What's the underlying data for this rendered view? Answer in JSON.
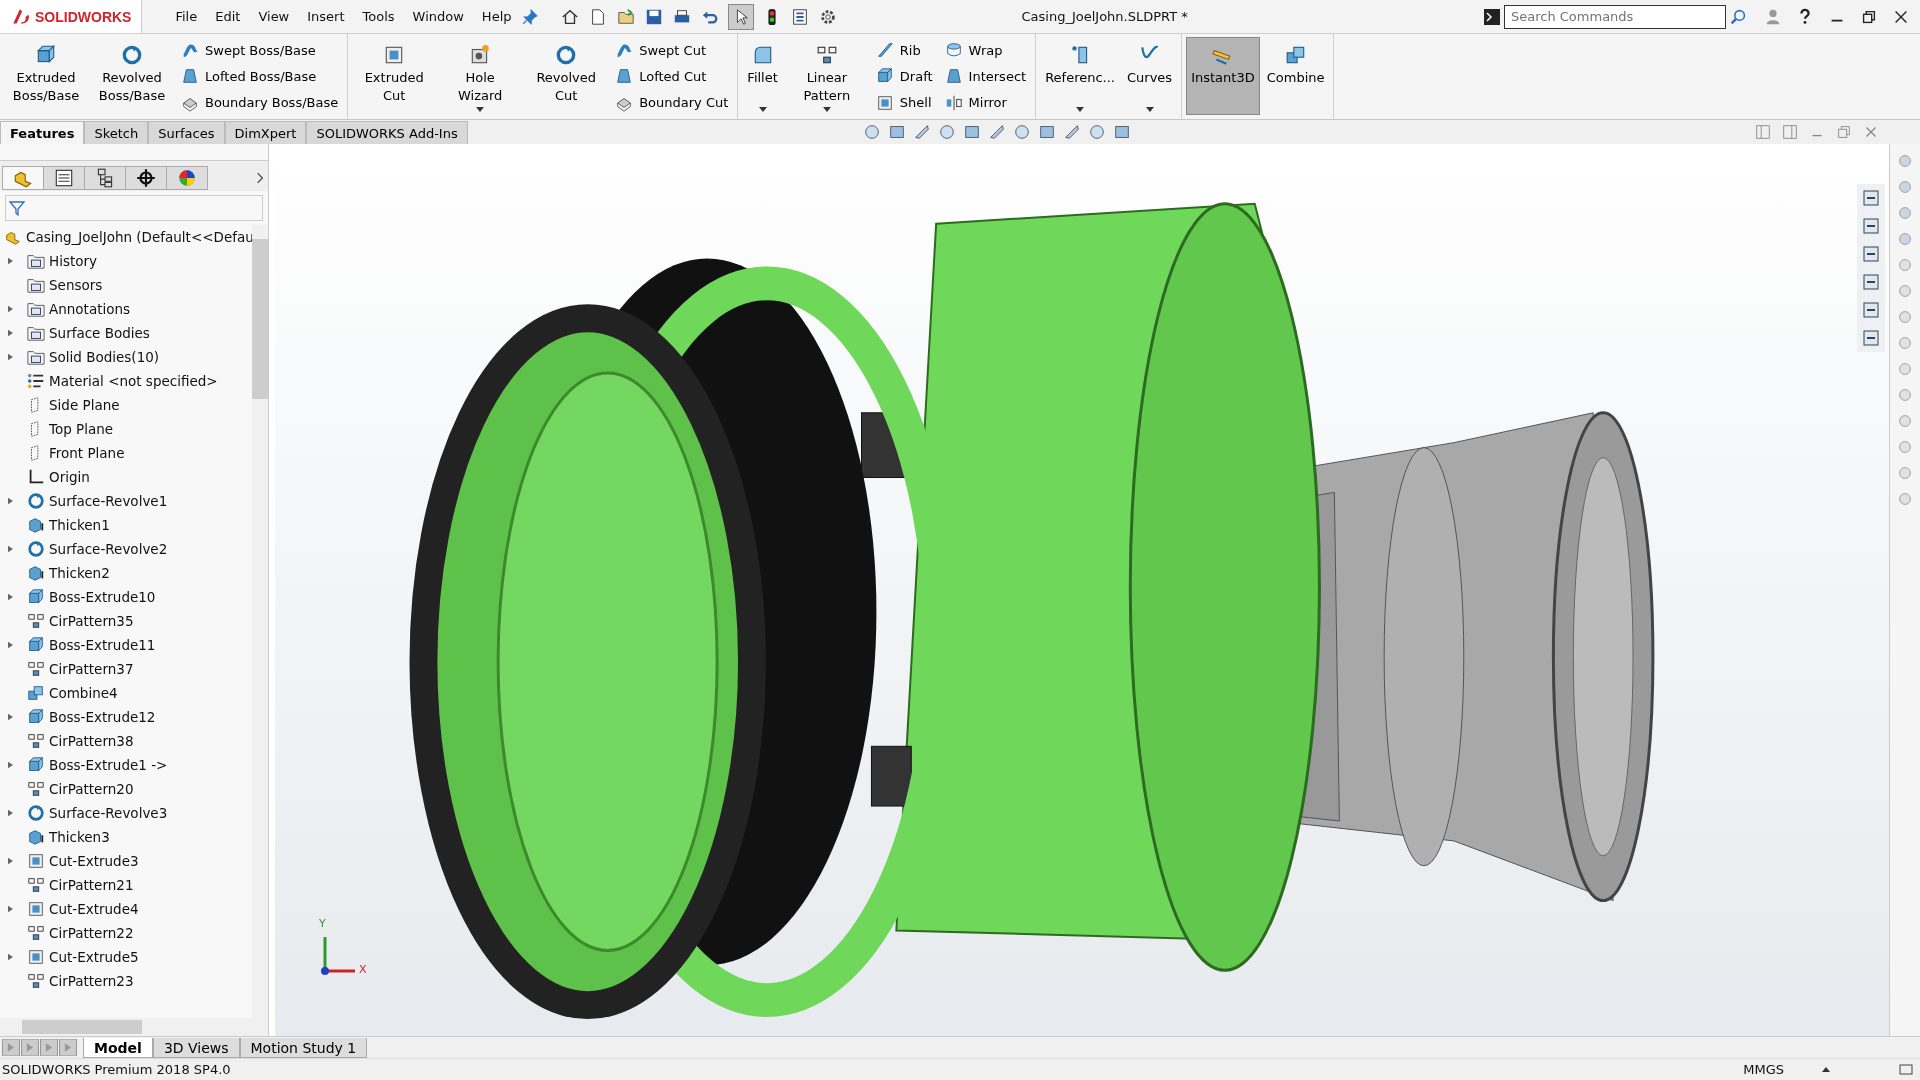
{
  "logo": "SOLIDWORKS",
  "menu": [
    "File",
    "Edit",
    "View",
    "Insert",
    "Tools",
    "Window",
    "Help"
  ],
  "title": "Casing_JoelJohn.SLDPRT *",
  "search": {
    "placeholder": "Search Commands"
  },
  "ribbon": [
    {
      "columns": [
        {
          "kind": "large",
          "buttons": [
            {
              "label": "Extruded Boss/Base",
              "kind": "extrude",
              "dropdown": false,
              "on": false
            }
          ]
        },
        {
          "kind": "large",
          "buttons": [
            {
              "label": "Revolved Boss/Base",
              "kind": "revolve",
              "dropdown": false,
              "on": false
            }
          ]
        },
        {
          "kind": "stack",
          "buttons": [
            {
              "label": "Swept Boss/Base",
              "kind": "sweep"
            },
            {
              "label": "Lofted Boss/Base",
              "kind": "loft"
            },
            {
              "label": "Boundary Boss/Base",
              "kind": "boundary"
            }
          ]
        }
      ]
    },
    {
      "columns": [
        {
          "kind": "large",
          "buttons": [
            {
              "label": "Extruded Cut",
              "kind": "cut",
              "dropdown": false,
              "on": false
            }
          ]
        },
        {
          "kind": "large",
          "buttons": [
            {
              "label": "Hole Wizard",
              "kind": "hole",
              "dropdown": true,
              "on": false
            }
          ]
        },
        {
          "kind": "large",
          "buttons": [
            {
              "label": "Revolved Cut",
              "kind": "revolve",
              "dropdown": false,
              "on": false
            }
          ]
        },
        {
          "kind": "stack",
          "buttons": [
            {
              "label": "Swept Cut",
              "kind": "sweep"
            },
            {
              "label": "Lofted Cut",
              "kind": "loft"
            },
            {
              "label": "Boundary Cut",
              "kind": "boundary"
            }
          ]
        }
      ]
    },
    {
      "columns": [
        {
          "kind": "large",
          "buttons": [
            {
              "label": "Fillet",
              "kind": "fillet",
              "dropdown": true,
              "on": false
            }
          ]
        },
        {
          "kind": "large",
          "buttons": [
            {
              "label": "Linear Pattern",
              "kind": "pattern",
              "dropdown": true,
              "on": false
            }
          ]
        },
        {
          "kind": "stack",
          "buttons": [
            {
              "label": "Rib",
              "kind": "rib"
            },
            {
              "label": "Draft",
              "kind": "extrude"
            },
            {
              "label": "Shell",
              "kind": "cut"
            }
          ]
        },
        {
          "kind": "stack",
          "buttons": [
            {
              "label": "Wrap",
              "kind": "wrap"
            },
            {
              "label": "Intersect",
              "kind": "loft"
            },
            {
              "label": "Mirror",
              "kind": "mirror"
            }
          ]
        }
      ]
    },
    {
      "columns": [
        {
          "kind": "large",
          "buttons": [
            {
              "label": "Referenc...",
              "kind": "plane",
              "dropdown": true,
              "on": false
            }
          ]
        },
        {
          "kind": "large",
          "buttons": [
            {
              "label": "Curves",
              "kind": "curve",
              "dropdown": true,
              "on": false
            }
          ]
        }
      ]
    },
    {
      "columns": [
        {
          "kind": "large",
          "buttons": [
            {
              "label": "Instant3D",
              "kind": "ruler",
              "dropdown": false,
              "on": true
            }
          ]
        },
        {
          "kind": "large",
          "buttons": [
            {
              "label": "Combine",
              "kind": "combine",
              "dropdown": false,
              "on": false
            }
          ]
        }
      ]
    }
  ],
  "command_tabs": [
    {
      "label": "Features",
      "selected": true
    },
    {
      "label": "Sketch",
      "selected": false
    },
    {
      "label": "Surfaces",
      "selected": false
    },
    {
      "label": "DimXpert",
      "selected": false
    },
    {
      "label": "SOLIDWORKS Add-Ins",
      "selected": false
    }
  ],
  "tree": {
    "root": "Casing_JoelJohn  (Default<<Defau",
    "items": [
      {
        "label": "History",
        "kind": "folder",
        "expandable": true
      },
      {
        "label": "Sensors",
        "kind": "folder",
        "expandable": false
      },
      {
        "label": "Annotations",
        "kind": "folder",
        "expandable": true
      },
      {
        "label": "Surface Bodies",
        "kind": "folder",
        "expandable": true
      },
      {
        "label": "Solid Bodies(10)",
        "kind": "folder",
        "expandable": true
      },
      {
        "label": "Material <not specified>",
        "kind": "material",
        "expandable": false
      },
      {
        "label": "Side Plane",
        "kind": "plane",
        "expandable": false
      },
      {
        "label": "Top Plane",
        "kind": "plane",
        "expandable": false
      },
      {
        "label": "Front Plane",
        "kind": "plane",
        "expandable": false
      },
      {
        "label": "Origin",
        "kind": "origin",
        "expandable": false
      },
      {
        "label": "Surface-Revolve1",
        "kind": "revolve",
        "expandable": true
      },
      {
        "label": "Thicken1",
        "kind": "thicken",
        "expandable": false
      },
      {
        "label": "Surface-Revolve2",
        "kind": "revolve",
        "expandable": true
      },
      {
        "label": "Thicken2",
        "kind": "thicken",
        "expandable": false
      },
      {
        "label": "Boss-Extrude10",
        "kind": "extrude",
        "expandable": true
      },
      {
        "label": "CirPattern35",
        "kind": "pattern",
        "expandable": false
      },
      {
        "label": "Boss-Extrude11",
        "kind": "extrude",
        "expandable": true
      },
      {
        "label": "CirPattern37",
        "kind": "pattern",
        "expandable": false
      },
      {
        "label": "Combine4",
        "kind": "combine",
        "expandable": false
      },
      {
        "label": "Boss-Extrude12",
        "kind": "extrude",
        "expandable": true
      },
      {
        "label": "CirPattern38",
        "kind": "pattern",
        "expandable": false
      },
      {
        "label": "Boss-Extrude1 ->",
        "kind": "extrude",
        "expandable": true
      },
      {
        "label": "CirPattern20",
        "kind": "pattern",
        "expandable": false
      },
      {
        "label": "Surface-Revolve3",
        "kind": "revolve",
        "expandable": true
      },
      {
        "label": "Thicken3",
        "kind": "thicken",
        "expandable": false
      },
      {
        "label": "Cut-Extrude3",
        "kind": "cut",
        "expandable": true
      },
      {
        "label": "CirPattern21",
        "kind": "pattern",
        "expandable": false
      },
      {
        "label": "Cut-Extrude4",
        "kind": "cut",
        "expandable": true
      },
      {
        "label": "CirPattern22",
        "kind": "pattern",
        "expandable": false
      },
      {
        "label": "Cut-Extrude5",
        "kind": "cut",
        "expandable": true
      },
      {
        "label": "CirPattern23",
        "kind": "pattern",
        "expandable": false
      }
    ]
  },
  "triad": {
    "x": "X",
    "y": "Y"
  },
  "bottom_tabs": [
    {
      "label": "Model",
      "selected": true
    },
    {
      "label": "3D Views",
      "selected": false
    },
    {
      "label": "Motion Study 1",
      "selected": false
    }
  ],
  "status": {
    "text": "SOLIDWORKS Premium 2018 SP4.0",
    "units": "MMGS"
  }
}
